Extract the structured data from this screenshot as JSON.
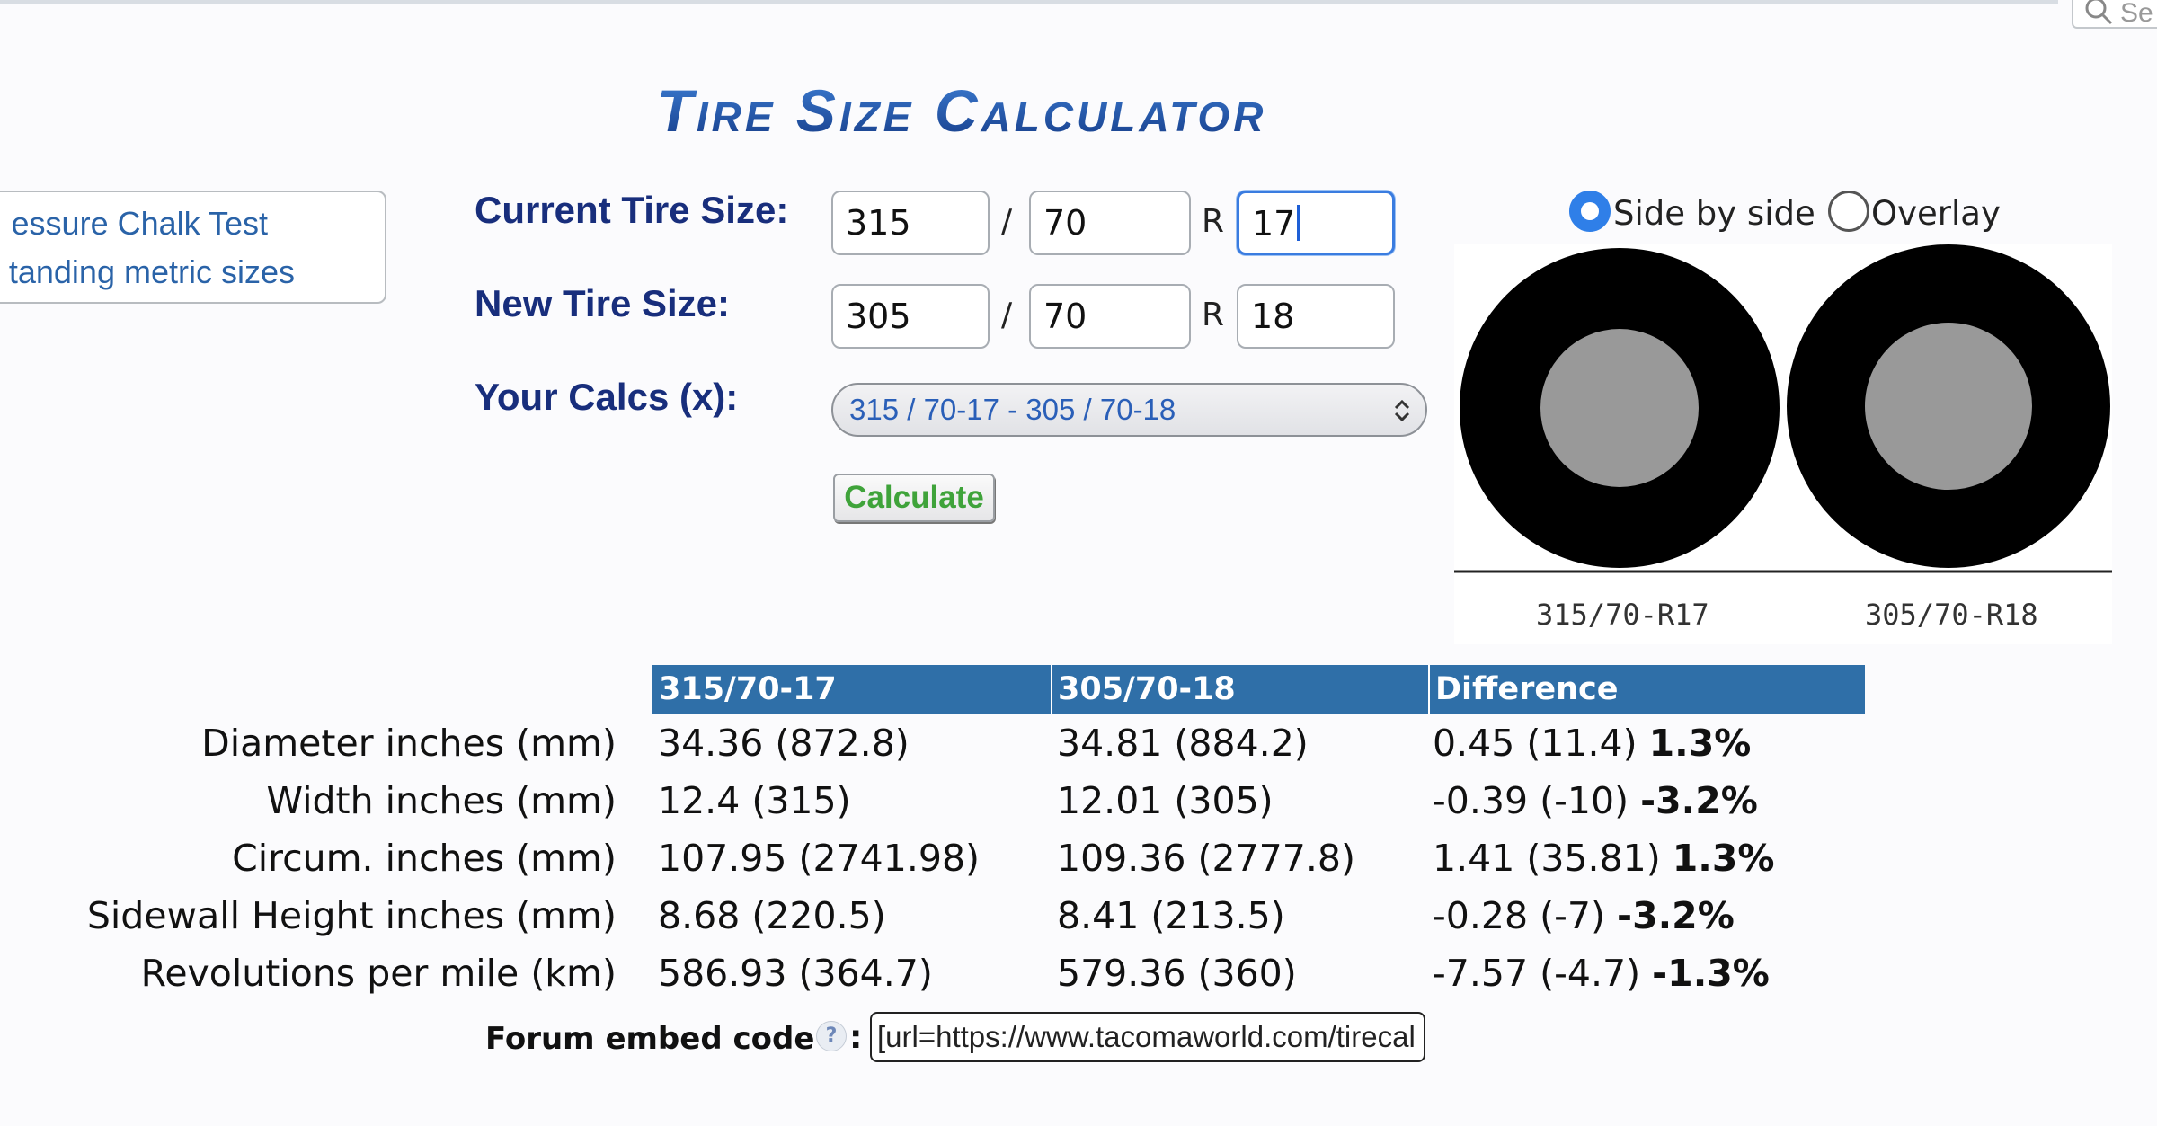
{
  "header": {
    "title": "Tire Size Calculator",
    "search_partial": "Se"
  },
  "side_links": [
    {
      "label": "essure Chalk Test"
    },
    {
      "label": "tanding metric sizes"
    }
  ],
  "form": {
    "current_label": "Current Tire Size:",
    "new_label": "New Tire Size:",
    "calcs_label": "Your Calcs (x):",
    "current": {
      "width": "315",
      "ratio": "70",
      "rim": "17"
    },
    "new": {
      "width": "305",
      "ratio": "70",
      "rim": "18"
    },
    "slash": "/",
    "r": "R",
    "calcs_selected": "315 / 70-17 - 305 / 70-18",
    "calculate_label": "Calculate"
  },
  "view_options": {
    "side_by_side": "Side by side",
    "overlay": "Overlay",
    "selected": "side_by_side"
  },
  "diagram": {
    "tires": [
      {
        "caption": "315/70-R17",
        "diameter_in": 34.36,
        "rim_in": 17
      },
      {
        "caption": "305/70-R18",
        "diameter_in": 34.81,
        "rim_in": 18
      }
    ]
  },
  "results": {
    "columns": [
      "315/70-17",
      "305/70-18",
      "Difference"
    ],
    "rows": [
      {
        "label": "Diameter inches (mm)",
        "current": "34.36 (872.8)",
        "new": "34.81 (884.2)",
        "diff": "0.45 (11.4)",
        "pct": "1.3%"
      },
      {
        "label": "Width inches (mm)",
        "current": "12.4 (315)",
        "new": "12.01 (305)",
        "diff": "-0.39 (-10)",
        "pct": "-3.2%"
      },
      {
        "label": "Circum. inches (mm)",
        "current": "107.95 (2741.98)",
        "new": "109.36 (2777.8)",
        "diff": "1.41 (35.81)",
        "pct": "1.3%"
      },
      {
        "label": "Sidewall Height inches (mm)",
        "current": "8.68 (220.5)",
        "new": "8.41 (213.5)",
        "diff": "-0.28 (-7)",
        "pct": "-3.2%"
      },
      {
        "label": "Revolutions per mile (km)",
        "current": "586.93 (364.7)",
        "new": "579.36 (360)",
        "diff": "-7.57 (-4.7)",
        "pct": "-1.3%"
      }
    ]
  },
  "embed": {
    "label": "Forum embed code",
    "help": "?",
    "colon": ":",
    "value": "[url=https://www.tacomaworld.com/tirecal"
  },
  "colors": {
    "title": "#1d57a6",
    "header_bg": "#2f6fa8",
    "calculate": "#3fa33a",
    "link": "#2a63a8"
  }
}
